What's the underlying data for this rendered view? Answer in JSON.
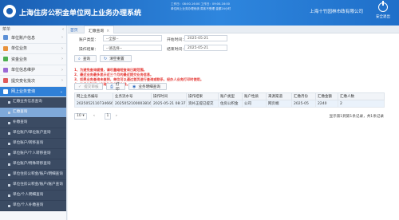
{
  "header": {
    "title": "上海住房公积金单位网上业务办理系统",
    "notice_lines": [
      "工作日：08:00-16:00  工作日：09:00-16:00",
      "单位网上业务办理系统 周末不受理 金额24小时"
    ],
    "org_name": "上海十竹园林市政有限公司",
    "exit_label": "安全退出"
  },
  "sidebar": {
    "menu_label": "菜单",
    "items": [
      {
        "label": "单位账户信息",
        "icon_color": "#5b8fd6"
      },
      {
        "label": "单位业务",
        "icon_color": "#e8913a"
      },
      {
        "label": "资金业务",
        "icon_color": "#4caf50"
      },
      {
        "label": "单位信息维护",
        "icon_color": "#9c6ad6"
      },
      {
        "label": "提交变化批次",
        "icon_color": "#e05b5b"
      },
      {
        "label": "网上业务查询",
        "icon_color": "#ffffff"
      }
    ],
    "sub_items": [
      "汇缴业务信息查询",
      "汇缴查询",
      "补缴查询",
      "单位账户/单位账户查询",
      "单位账户/转移查询",
      "单位账户/个人转移查询",
      "单位账户/特殊转移查询",
      "单位住房公积金/账户/明细查询",
      "单位住房公积金/账户/账户查询",
      "单位/个人明细查询",
      "单位/个人补缴查询"
    ],
    "selected_sub": 1
  },
  "tabs": {
    "home": "首页",
    "current": "汇缴查询"
  },
  "form": {
    "account_type_label": "账户类型：",
    "account_type_value": "--全部--",
    "start_date_label": "开始时间：",
    "start_date_value": "2025-05-21",
    "op_result_label": "操作结果：",
    "op_result_value": "--请选择--",
    "end_date_label": "结束时间：",
    "end_date_value": "2025-05-21",
    "query_btn": "查询",
    "reset_btn": "清空重置"
  },
  "warnings": [
    "1、为避免查询缓慢，请尽量缩短查询日期范围。",
    "2、最近业务最多显示近三个月的最近提交业务信息。",
    "3、如果业务查询未查到，单位可以通过首页进行查询或联系，经办人业务打印时使用。",
    "4、有多的数据以查询为准并以为准。"
  ],
  "actions": {
    "submit": "提交审核",
    "print": "打印",
    "detail": "业务明细查询"
  },
  "table": {
    "columns": [
      "网上业务编号",
      "业务流水号",
      "操作时间",
      "操作结果",
      "账户类型",
      "账户性质",
      "来源渠道",
      "汇缴月份",
      "汇缴金额",
      "汇缴人数"
    ],
    "rows": [
      [
        "20250521107346666",
        "2025052100003816",
        "2025-05-21 08:37:09",
        "资补正提已提交",
        "住房公积金",
        "公司",
        "网页端",
        "2025-05",
        "2240",
        "2"
      ]
    ]
  },
  "pager": {
    "page_size": "10",
    "page": "1",
    "info": "显示第1到第1条记录，共1条记录"
  }
}
